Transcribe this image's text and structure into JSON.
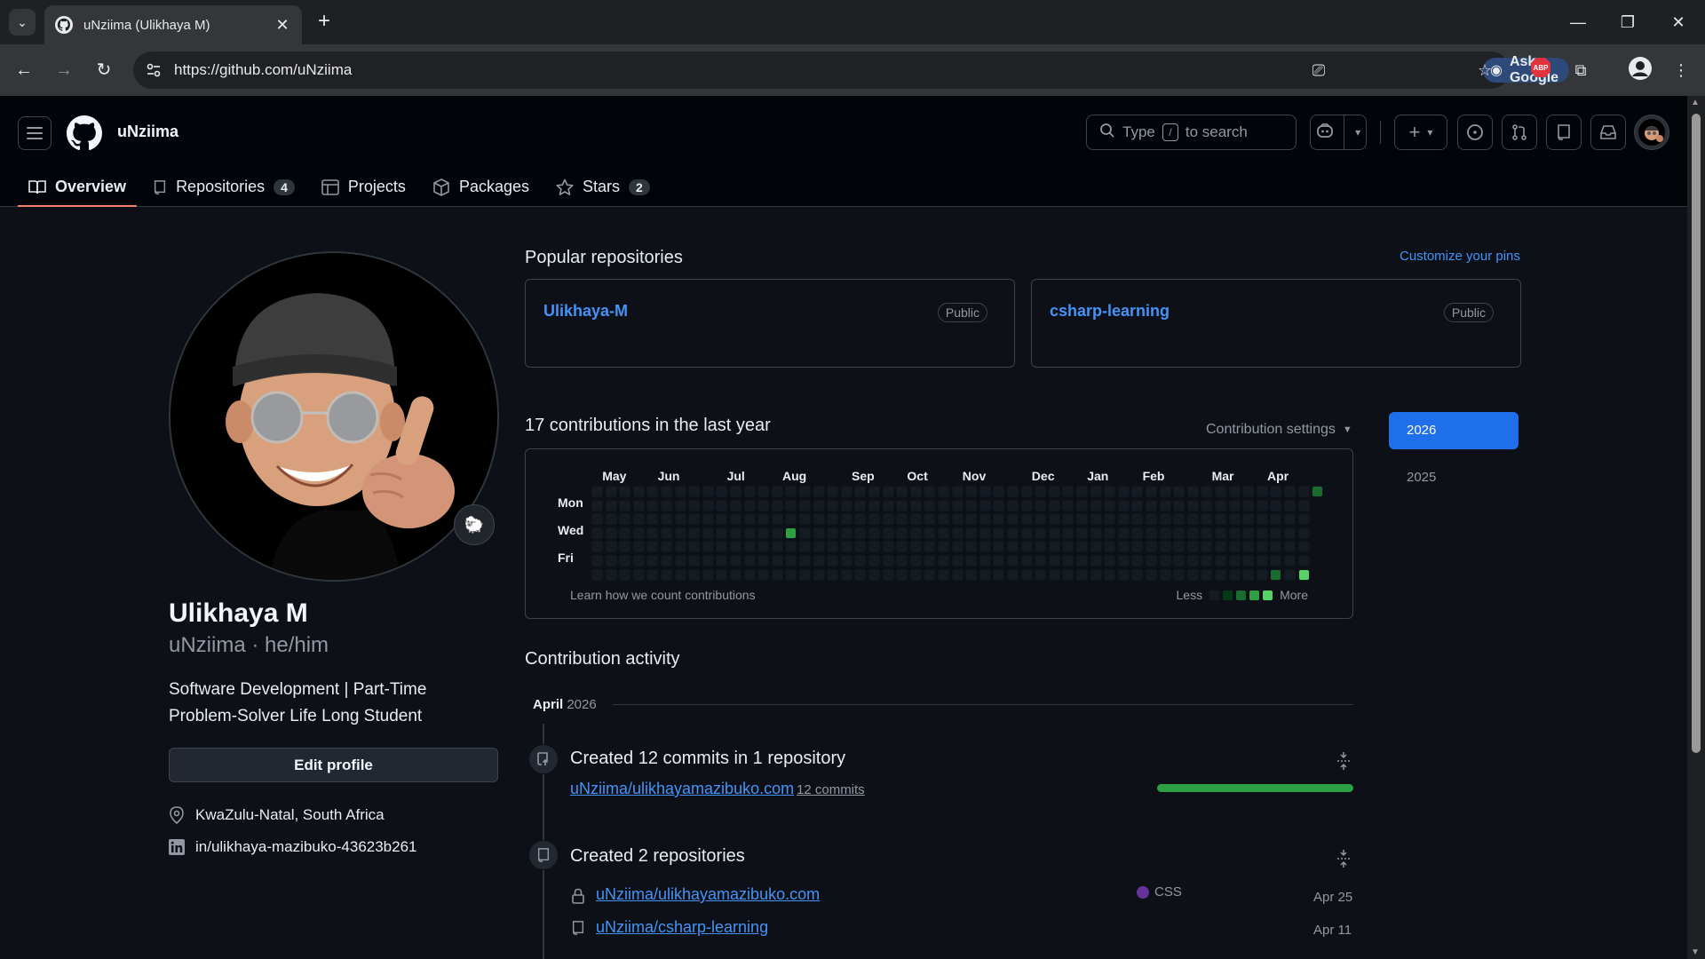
{
  "browser": {
    "tab_title": "uNziima (Ulikhaya M)",
    "url": "https://github.com/uNziima",
    "ask_google": "Ask Google"
  },
  "header": {
    "username": "uNziima",
    "search_prefix": "Type",
    "search_key": "/",
    "search_suffix": "to search"
  },
  "subnav": [
    {
      "label": "Overview",
      "count": null,
      "icon": "book-icon"
    },
    {
      "label": "Repositories",
      "count": "4",
      "icon": "repo-icon"
    },
    {
      "label": "Projects",
      "count": null,
      "icon": "table-icon"
    },
    {
      "label": "Packages",
      "count": null,
      "icon": "package-icon"
    },
    {
      "label": "Stars",
      "count": "2",
      "icon": "star-icon"
    }
  ],
  "profile": {
    "name": "Ulikhaya M",
    "handle": "uNziima · he/him",
    "bio": "Software Development | Part-Time Problem-Solver Life Long Student",
    "edit_label": "Edit profile",
    "location": "KwaZulu-Natal, South Africa",
    "linkedin": "in/ulikhaya-mazibuko-43623b261"
  },
  "popular": {
    "title": "Popular repositories",
    "customize": "Customize your pins",
    "repos": [
      {
        "name": "Ulikhaya-M",
        "visibility": "Public"
      },
      {
        "name": "csharp-learning",
        "visibility": "Public"
      }
    ]
  },
  "contributions": {
    "title": "17 contributions in the last year",
    "settings": "Contribution settings",
    "months": [
      "May",
      "Jun",
      "Jul",
      "Aug",
      "Sep",
      "Oct",
      "Nov",
      "Dec",
      "Jan",
      "Feb",
      "Mar",
      "Apr"
    ],
    "days": [
      "Mon",
      "Wed",
      "Fri"
    ],
    "learn": "Learn how we count contributions",
    "less": "Less",
    "more": "More",
    "levels": [
      "#151b23",
      "#033a16",
      "#196c2e",
      "#2ea043",
      "#56d364"
    ],
    "active_cells": [
      {
        "week": 14,
        "day": 3,
        "level": 3
      },
      {
        "week": 49,
        "day": 6,
        "level": 2
      },
      {
        "week": 51,
        "day": 6,
        "level": 4
      },
      {
        "week": 52,
        "day": 0,
        "level": 2
      }
    ]
  },
  "years": {
    "selected": "2026",
    "other": "2025"
  },
  "activity": {
    "title": "Contribution activity",
    "month_bold": "April",
    "month_year": "2026",
    "commits": {
      "title": "Created 12 commits in 1 repository",
      "repo": "uNziima/ulikhayamazibuko.com",
      "count": "12 commits",
      "progress": 1.0
    },
    "repos_created": {
      "title": "Created 2 repositories",
      "items": [
        {
          "name": "uNziima/ulikhayamazibuko.com",
          "lang": "CSS",
          "date": "Apr 25",
          "icon": "lock-icon"
        },
        {
          "name": "uNziima/csharp-learning",
          "lang": "",
          "date": "Apr 11",
          "icon": "repo-icon"
        }
      ]
    }
  }
}
